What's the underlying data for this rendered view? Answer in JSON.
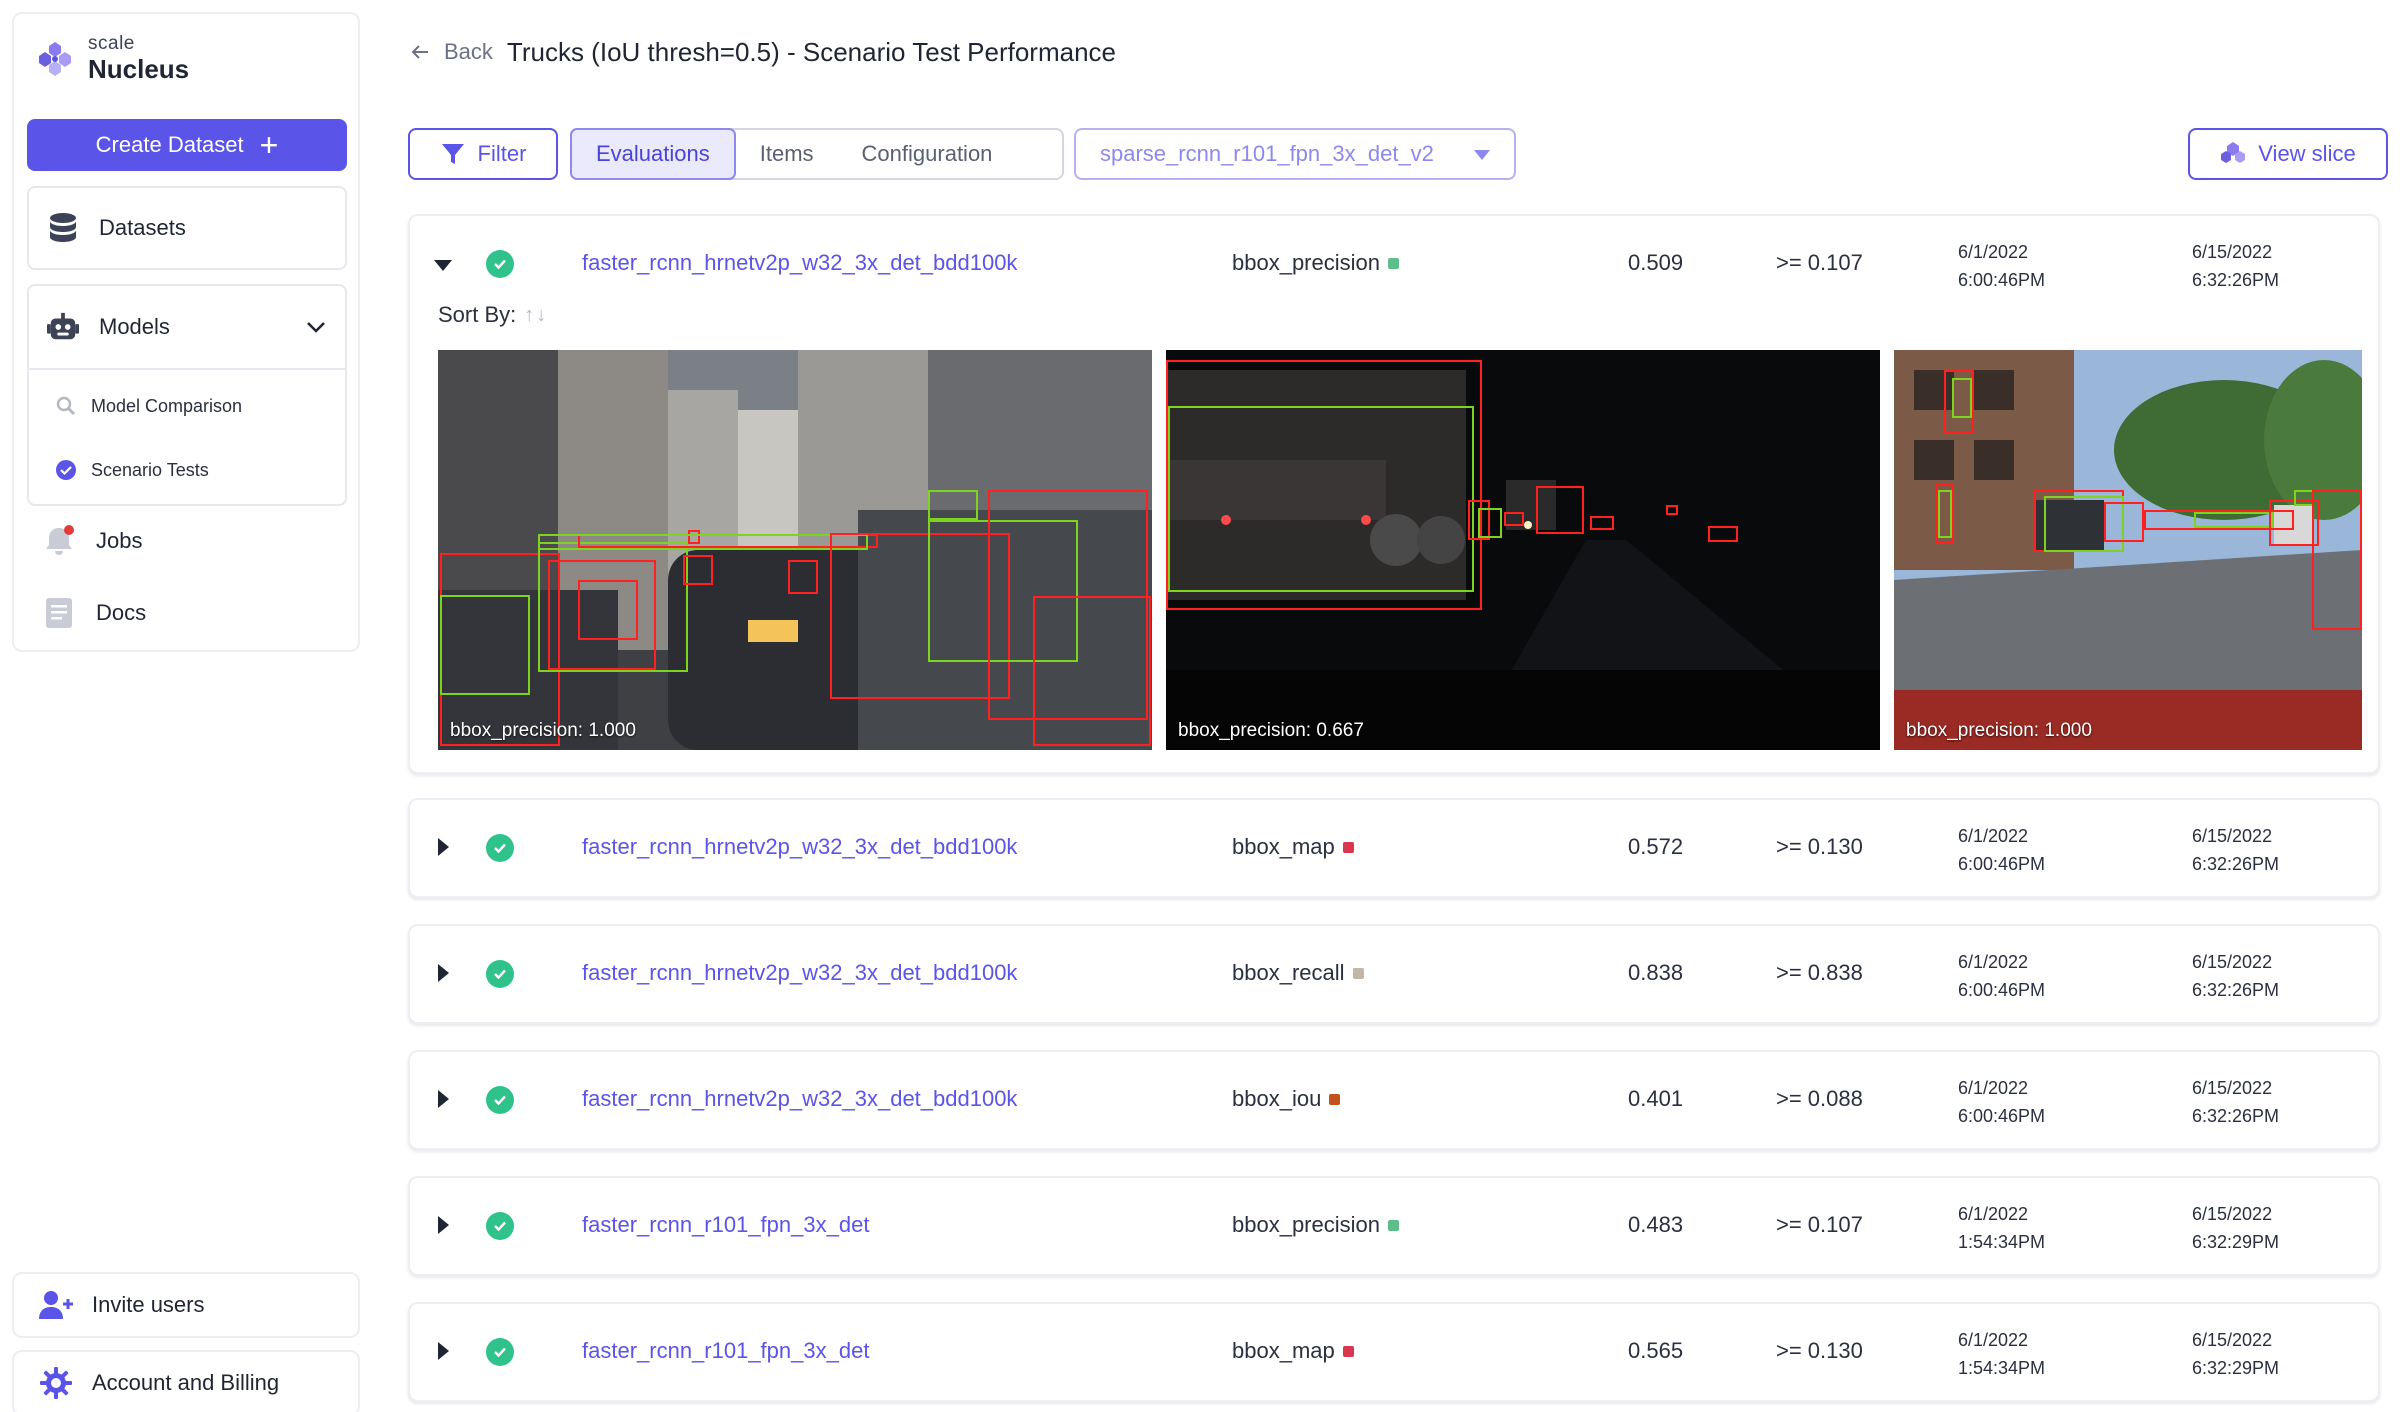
{
  "brand": {
    "scale": "scale",
    "product": "Nucleus"
  },
  "sidebar": {
    "create_label": "Create Dataset",
    "datasets_label": "Datasets",
    "models_label": "Models",
    "model_comparison_label": "Model Comparison",
    "scenario_tests_label": "Scenario Tests",
    "jobs_label": "Jobs",
    "docs_label": "Docs",
    "invite_label": "Invite users",
    "account_label": "Account and Billing"
  },
  "header": {
    "back_label": "Back",
    "title": "Trucks (IoU thresh=0.5) - Scenario Test Performance"
  },
  "toolbar": {
    "filter_label": "Filter",
    "tabs": [
      {
        "label": "Evaluations"
      },
      {
        "label": "Items"
      },
      {
        "label": "Configuration"
      }
    ],
    "model_select_value": "sparse_rcnn_r101_fpn_3x_det_v2",
    "view_slice_label": "View slice"
  },
  "colors": {
    "accent": "#5b54e8",
    "success": "#2fc28b"
  },
  "sort_by_label": "Sort By:",
  "rows": [
    {
      "model": "faster_rcnn_hrnetv2p_w32_3x_det_bdd100k",
      "metric": "bbox_precision",
      "metric_color": "#5cbf8a",
      "score": "0.509",
      "threshold": ">= 0.107",
      "created_date": "6/1/2022",
      "created_time": "6:00:46PM",
      "updated_date": "6/15/2022",
      "updated_time": "6:32:26PM"
    },
    {
      "model": "faster_rcnn_hrnetv2p_w32_3x_det_bdd100k",
      "metric": "bbox_map",
      "metric_color": "#d9364f",
      "score": "0.572",
      "threshold": ">= 0.130",
      "created_date": "6/1/2022",
      "created_time": "6:00:46PM",
      "updated_date": "6/15/2022",
      "updated_time": "6:32:26PM"
    },
    {
      "model": "faster_rcnn_hrnetv2p_w32_3x_det_bdd100k",
      "metric": "bbox_recall",
      "metric_color": "#c2b6a8",
      "score": "0.838",
      "threshold": ">= 0.838",
      "created_date": "6/1/2022",
      "created_time": "6:00:46PM",
      "updated_date": "6/15/2022",
      "updated_time": "6:32:26PM"
    },
    {
      "model": "faster_rcnn_hrnetv2p_w32_3x_det_bdd100k",
      "metric": "bbox_iou",
      "metric_color": "#c4521f",
      "score": "0.401",
      "threshold": ">= 0.088",
      "created_date": "6/1/2022",
      "created_time": "6:00:46PM",
      "updated_date": "6/15/2022",
      "updated_time": "6:32:26PM"
    },
    {
      "model": "faster_rcnn_r101_fpn_3x_det",
      "metric": "bbox_precision",
      "metric_color": "#5cbf8a",
      "score": "0.483",
      "threshold": ">= 0.107",
      "created_date": "6/1/2022",
      "created_time": "1:54:34PM",
      "updated_date": "6/15/2022",
      "updated_time": "6:32:29PM"
    },
    {
      "model": "faster_rcnn_r101_fpn_3x_det",
      "metric": "bbox_map",
      "metric_color": "#d9364f",
      "score": "0.565",
      "threshold": ">= 0.130",
      "created_date": "6/1/2022",
      "created_time": "1:54:34PM",
      "updated_date": "6/15/2022",
      "updated_time": "6:32:29PM"
    }
  ],
  "thumbnails": [
    {
      "caption": "bbox_precision: 1.000"
    },
    {
      "caption": "bbox_precision: 0.667"
    },
    {
      "caption": "bbox_precision: 1.000"
    }
  ]
}
